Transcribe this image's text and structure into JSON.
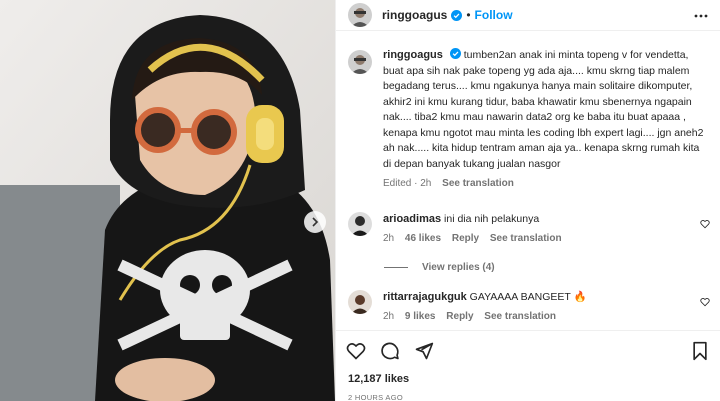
{
  "post": {
    "author": "ringgoagus",
    "follow_label": "Follow",
    "separator": "•",
    "caption": "tumben2an anak ini minta topeng v for vendetta, buat apa sih nak pake topeng yg ada aja.... kmu skrng tiap malem begadang terus.... kmu ngakunya hanya main solitaire dikomputer, akhir2 ini kmu kurang tidur, baba khawatir kmu sbenernya ngapain nak.... tiba2 kmu mau nawarin data2 org ke baba itu buat apaaa , kenapa kmu ngotot mau minta les coding lbh expert lagi.... jgn aneh2 ah nak..... kita hidup tentram aman aja ya.. kenapa skrng rumah kita di depan banyak tukang jualan nasgor",
    "caption_meta": {
      "edited": "Edited · 2h",
      "see_translation": "See translation"
    },
    "likes": "12,187 likes",
    "time_ago": "2 HOURS AGO"
  },
  "comments": [
    {
      "user": "arioadimas",
      "text": "ini dia nih pelakunya",
      "age": "2h",
      "likes": "46 likes",
      "reply": "Reply",
      "see_translation": "See translation"
    },
    {
      "user": "rittarrajagukguk",
      "text": "GAYAAAA BANGEET 🔥",
      "age": "2h",
      "likes": "9 likes",
      "reply": "Reply",
      "see_translation": "See translation"
    }
  ],
  "view_replies": "View replies (4)",
  "icons": [
    "heart-icon",
    "comment-icon",
    "share-icon",
    "bookmark-icon",
    "more-icon",
    "verified-icon",
    "next-arrow-icon"
  ],
  "colors": {
    "link": "#0095f6",
    "verified": "#0095f6",
    "muted": "#737373",
    "text": "#262626",
    "divider": "#efefef"
  }
}
